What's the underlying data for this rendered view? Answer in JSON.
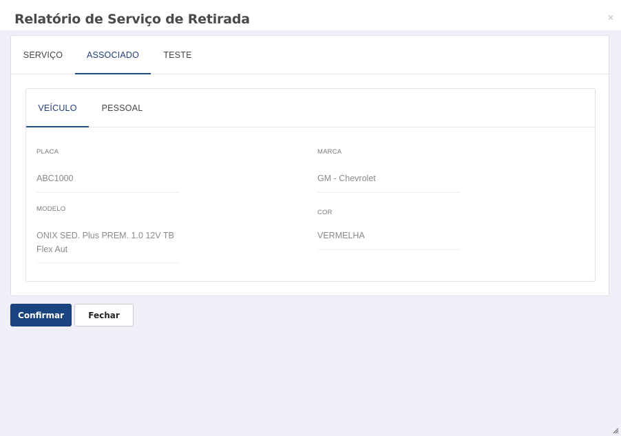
{
  "modal": {
    "title": "Relatório de Serviço de Retirada",
    "close_glyph": "×"
  },
  "outer_tabs": [
    {
      "label": "SERVIÇO",
      "active": false
    },
    {
      "label": "ASSOCIADO",
      "active": true
    },
    {
      "label": "TESTE",
      "active": false
    }
  ],
  "inner_tabs": [
    {
      "label": "VEÍCULO",
      "active": true
    },
    {
      "label": "PESSOAL",
      "active": false
    }
  ],
  "fields": {
    "placa": {
      "label": "PLACA",
      "value": "ABC1000"
    },
    "marca": {
      "label": "MARCA",
      "value": "GM - Chevrolet"
    },
    "modelo": {
      "label": "MODELO",
      "value_line1": "ONIX SED. Plus PREM. 1.0 12V TB",
      "value_line2": "Flex Aut"
    },
    "cor": {
      "label": "COR",
      "value": "VERMELHA"
    }
  },
  "buttons": {
    "confirm": "Confirmar",
    "close": "Fechar"
  },
  "colors": {
    "primary": "#1a4480",
    "active_tab": "#1f4f85",
    "background": "#efeff8"
  },
  "icons": {
    "close": "close-icon",
    "resize": "resize-handle-icon"
  }
}
